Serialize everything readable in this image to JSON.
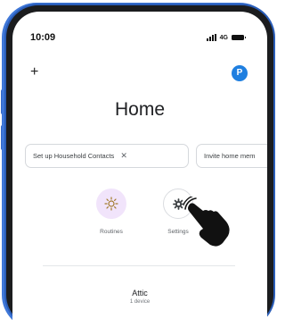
{
  "status_bar": {
    "time": "10:09",
    "network": "4G"
  },
  "header": {
    "add_icon": "plus-icon",
    "avatar_letter": "P"
  },
  "page": {
    "title": "Home"
  },
  "chips": [
    {
      "label": "Set up Household Contacts",
      "close_icon": "close-icon"
    },
    {
      "label": "Invite home mem"
    }
  ],
  "actions": [
    {
      "label": "Routines",
      "icon": "routines-icon"
    },
    {
      "label": "Settings",
      "icon": "gear-icon"
    }
  ],
  "room": {
    "name": "Attic",
    "device_count": "1 device"
  },
  "colors": {
    "avatar": "#1f7fe0",
    "routines_bg": "#f1e4fb",
    "frame": "#2a5db8"
  }
}
